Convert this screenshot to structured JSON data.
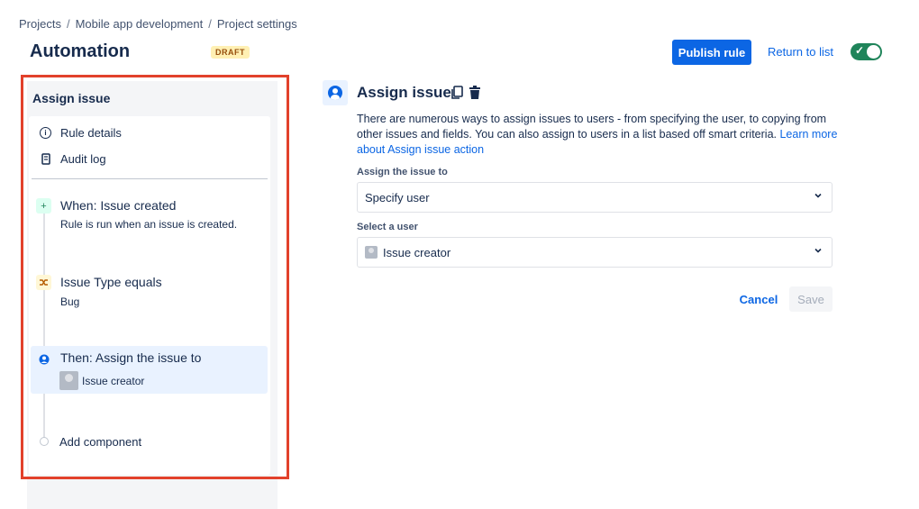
{
  "breadcrumb": [
    "Projects",
    "Mobile app development",
    "Project settings"
  ],
  "breadcrumb_separator": "/",
  "page_title": "Automation",
  "draft_badge": "DRAFT",
  "header": {
    "publish_label": "Publish rule",
    "return_label": "Return to list",
    "toggle_on": true,
    "toggle_color": "#1f845a"
  },
  "sidebar": {
    "heading": "Assign issue",
    "nav": [
      {
        "label": "Rule details",
        "icon": "info-icon"
      },
      {
        "label": "Audit log",
        "icon": "document-icon"
      }
    ],
    "steps": [
      {
        "title": "When: Issue created",
        "sub": "Rule is run when an issue is created.",
        "icon": "plus-icon"
      },
      {
        "title": "Issue Type equals",
        "sub": "Bug",
        "icon": "branch-icon"
      },
      {
        "title": "Then: Assign the issue to",
        "sub": "Issue creator",
        "icon": "person-icon",
        "active": true
      }
    ],
    "add_component": "Add component",
    "highlight_color": "#e2412b"
  },
  "action": {
    "title": "Assign issue",
    "description_text": "There are numerous ways to assign issues to users - from specifying the user, to copying from other issues and fields. You can also assign to users in a list based off smart criteria.",
    "description_link": "Learn more about Assign issue action",
    "field1_label": "Assign the issue to",
    "field1_value": "Specify user",
    "field2_label": "Select a user",
    "field2_value": "Issue creator",
    "cancel_label": "Cancel",
    "save_label": "Save"
  },
  "colors": {
    "primary": "#0c66e4",
    "text": "#172b4d"
  }
}
